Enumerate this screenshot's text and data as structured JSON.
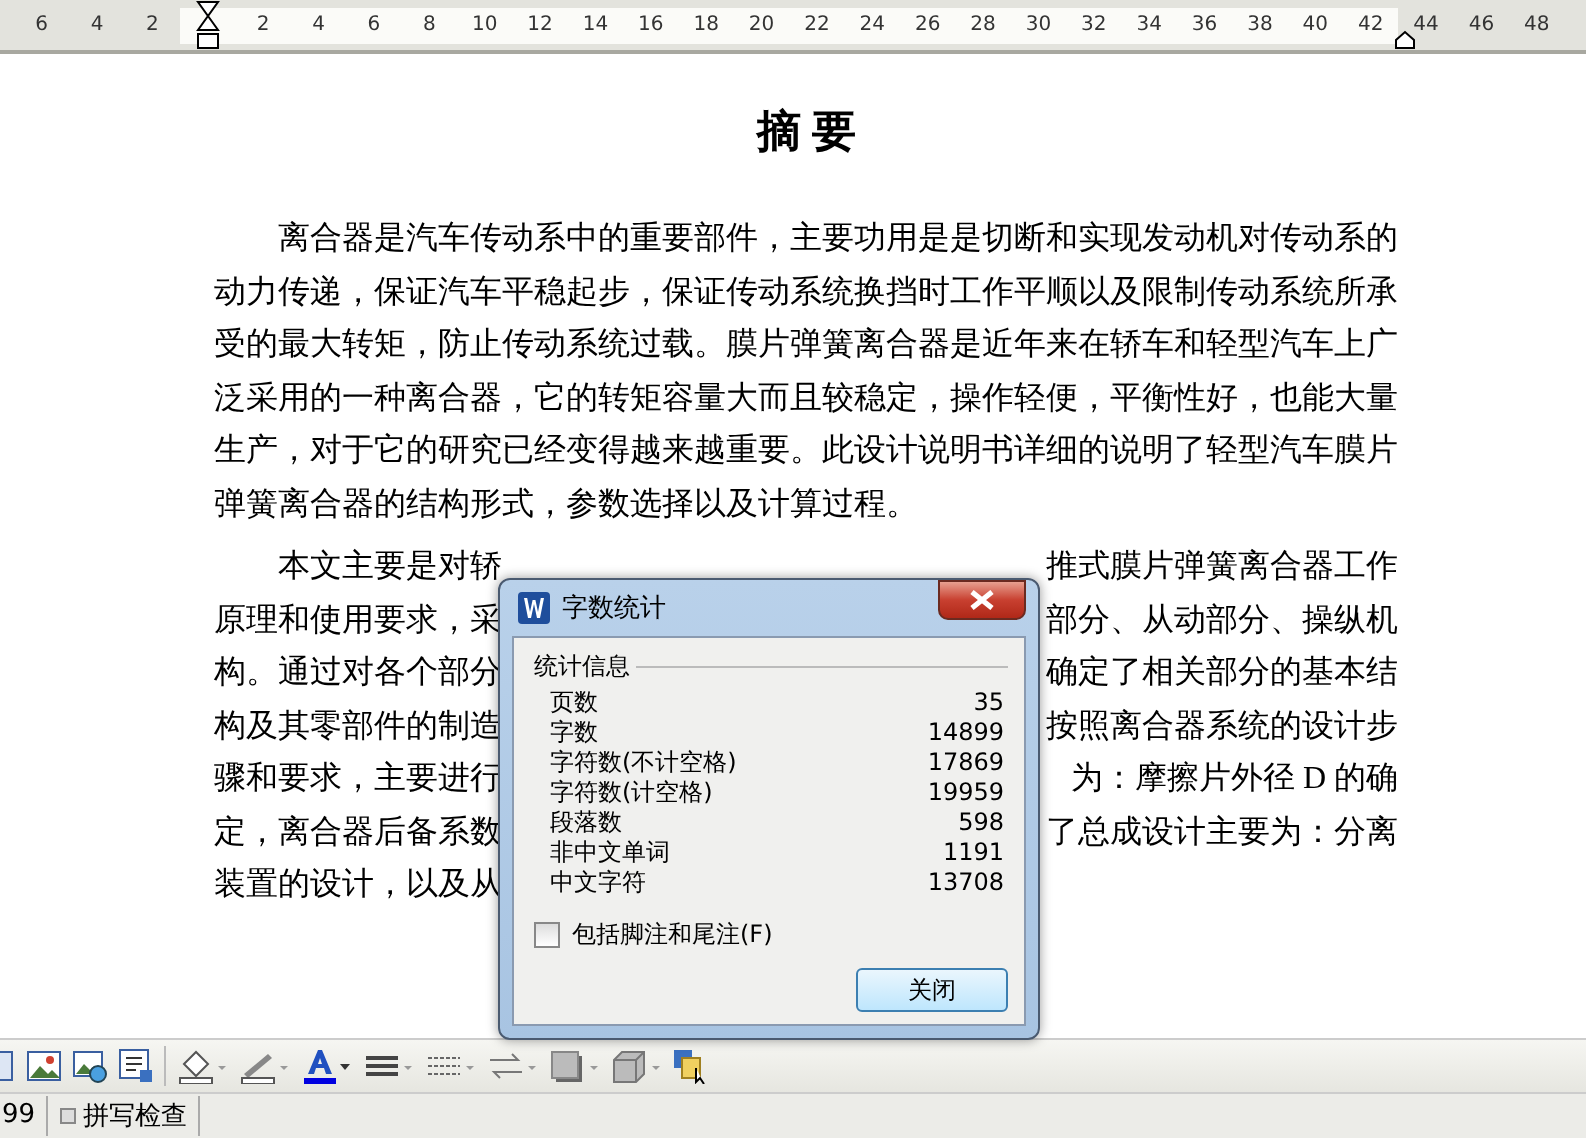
{
  "ruler": {
    "left_numbers": [
      "6",
      "4",
      "2"
    ],
    "numbers": [
      "2",
      "4",
      "6",
      "8",
      "10",
      "12",
      "14",
      "16",
      "18",
      "20",
      "22",
      "24",
      "26",
      "28",
      "30",
      "32",
      "34",
      "36",
      "38",
      "40",
      "42"
    ],
    "right_numbers": [
      "44",
      "46",
      "48"
    ]
  },
  "document": {
    "title": "摘 要",
    "paragraph": "离合器是汽车传动系中的重要部件，主要功用是是切断和实现发动机对传动系的动力传递，保证汽车平稳起步，保证传动系统换挡时工作平顺以及限制传动系统所承受的最大转矩，防止传动系统过载。膜片弹簧离合器是近年来在轿车和轻型汽车上广泛采用的一种离合器，它的转矩容量大而且较稳定，操作轻便，平衡性好，也能大量生产，对于它的研究已经变得越来越重要。此设计说明书详细的说明了轻型汽车膜片弹簧离合器的结构形式，参数选择以及计算过程。",
    "covered_lines": [
      {
        "left": "本文主要是对轿",
        "right": "推式膜片弹簧离合器工作"
      },
      {
        "left": "原理和使用要求，采",
        "right": "部分、从动部分、操纵机"
      },
      {
        "left": "构。通过对各个部分",
        "right": "确定了相关部分的基本结"
      },
      {
        "left": "构及其零部件的制造",
        "right": "按照离合器系统的设计步"
      },
      {
        "left": "骤和要求，主要进行",
        "right": "为：摩擦片外径 D 的确"
      },
      {
        "left": "定，离合器后备系数",
        "right": "了总成设计主要为：分离"
      },
      {
        "left": "装置的设计，以及从"
      }
    ]
  },
  "dialog": {
    "title": "字数统计",
    "group": "统计信息",
    "stats": [
      {
        "label": "页数",
        "value": "35"
      },
      {
        "label": "字数",
        "value": "14899"
      },
      {
        "label": "字符数(不计空格)",
        "value": "17869"
      },
      {
        "label": "字符数(计空格)",
        "value": "19959"
      },
      {
        "label": "段落数",
        "value": "598"
      },
      {
        "label": "非中文单词",
        "value": "1191"
      },
      {
        "label": "中文字符",
        "value": "13708"
      }
    ],
    "checkbox": {
      "label": "包括脚注和尾注(F)",
      "checked": false
    },
    "button": "关闭"
  },
  "status_bar": {
    "page_count": "99",
    "spell_check": "拼写检查"
  }
}
